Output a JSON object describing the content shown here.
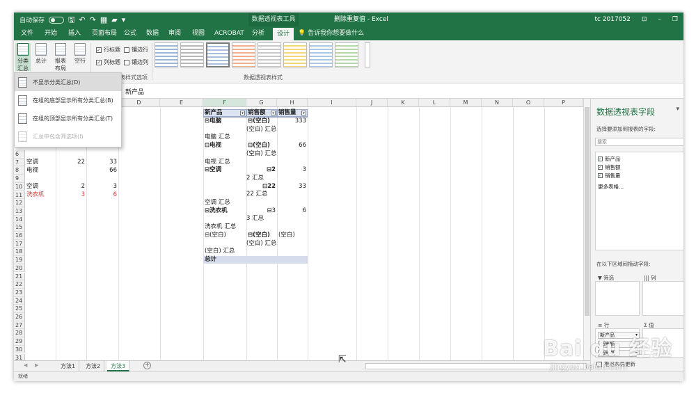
{
  "titlebar": {
    "autosave": "自动保存",
    "toggle_state": "关",
    "context_tool": "数据透视表工具",
    "title": "删除重复值 - Excel",
    "user": "tc 2017052"
  },
  "tabs": [
    "文件",
    "开始",
    "插入",
    "页面布局",
    "公式",
    "数据",
    "审阅",
    "视图",
    "ACROBAT",
    "分析",
    "设计"
  ],
  "active_tab": "设计",
  "tell_me": "告诉我你想要做什么",
  "ribbon": {
    "buttons": [
      "分类汇总",
      "总计",
      "报表布局",
      "空行"
    ],
    "checkboxes": [
      {
        "label": "行标题",
        "checked": true
      },
      {
        "label": "镶边行",
        "checked": false
      },
      {
        "label": "列标题",
        "checked": true
      },
      {
        "label": "镶边列",
        "checked": false
      }
    ],
    "group_options": "表样式选项",
    "group_styles": "数据透视表样式"
  },
  "formula_bar": {
    "value": "新产品"
  },
  "dropdown_menu": [
    {
      "label": "不显示分类汇总(D)",
      "hover": true,
      "disabled": false
    },
    {
      "label": "在组的底部显示所有分类汇总(B)",
      "hover": false,
      "disabled": false
    },
    {
      "label": "在组的顶部显示所有分类汇总(T)",
      "hover": false,
      "disabled": false
    },
    {
      "label": "汇总中包含筛选项(I)",
      "hover": false,
      "disabled": true
    }
  ],
  "columns": [
    "D",
    "E",
    "F",
    "G",
    "H",
    "I",
    "J",
    "K",
    "L",
    "M",
    "N",
    "O",
    "P"
  ],
  "selected_column": "F",
  "rows": [
    "6",
    "7",
    "8",
    "9",
    "10",
    "11",
    "12",
    "13",
    "14",
    "15",
    "16",
    "17",
    "18",
    "19",
    "20",
    "21",
    "22",
    "23",
    "24",
    "25",
    "26",
    "27",
    "28",
    "29",
    "30",
    "31"
  ],
  "left_table": [
    {
      "name": "空调",
      "b": "22",
      "c": "33",
      "red": false
    },
    {
      "name": "电视",
      "b": "",
      "c": "66",
      "red": false
    },
    {
      "name": "",
      "b": "",
      "c": "",
      "red": false
    },
    {
      "name": "空调",
      "b": "2",
      "c": "3",
      "red": false
    },
    {
      "name": "洗衣机",
      "b": "3",
      "c": "6",
      "red": true
    }
  ],
  "pivot": {
    "headers": [
      "新产品",
      "销售额",
      "销售量"
    ],
    "lines": [
      {
        "f": "⊟电脑",
        "g": "⊟(空白)",
        "h": "333",
        "bold_f": true
      },
      {
        "f": "",
        "g": "(空白) 汇总",
        "h": ""
      },
      {
        "f": "电脑 汇总",
        "g": "",
        "h": ""
      },
      {
        "f": "⊟电视",
        "g": "⊟(空白)",
        "h": "66",
        "bold_f": true
      },
      {
        "f": "",
        "g": "(空白) 汇总",
        "h": ""
      },
      {
        "f": "电视 汇总",
        "g": "",
        "h": ""
      },
      {
        "f": "⊟空调",
        "g": "⊟2",
        "h": "3",
        "bold_f": true
      },
      {
        "f": "",
        "g": "2 汇总",
        "h": ""
      },
      {
        "f": "",
        "g": "⊟22",
        "h": "33"
      },
      {
        "f": "",
        "g": "22 汇总",
        "h": ""
      },
      {
        "f": "空调 汇总",
        "g": "",
        "h": ""
      },
      {
        "f": "⊟洗衣机",
        "g": "⊟3",
        "h": "6",
        "bold_f": true
      },
      {
        "f": "",
        "g": "3 汇总",
        "h": ""
      },
      {
        "f": "洗衣机 汇总",
        "g": "",
        "h": ""
      },
      {
        "f": "⊟(空白)",
        "g": "⊟(空白)",
        "h": "(空白)"
      },
      {
        "f": "",
        "g": "(空白) 汇总",
        "h": ""
      },
      {
        "f": "(空白) 汇总",
        "g": "",
        "h": ""
      }
    ],
    "grand_total": "总计"
  },
  "pane": {
    "title": "数据透视表字段",
    "subtitle": "选择要添加到报表的字段:",
    "search_placeholder": "搜索",
    "fields": [
      {
        "label": "新产品",
        "checked": true
      },
      {
        "label": "销售额",
        "checked": true
      },
      {
        "label": "销售量",
        "checked": true
      }
    ],
    "more_tables": "更多表格...",
    "drag_hint": "在以下区域间拖动字段:",
    "zones": {
      "filter": "筛选",
      "columns": "列",
      "rows": "行",
      "values": "值"
    },
    "row_chips": [
      "新产品",
      "销售额",
      "销售量"
    ],
    "defer": "推迟布局更新"
  },
  "sheets": [
    "方法1",
    "方法2",
    "方法3"
  ],
  "active_sheet": "方法3",
  "status": "就绪",
  "watermark": {
    "big": "Bai du 经验",
    "small": "jingyan.baidu.com"
  }
}
